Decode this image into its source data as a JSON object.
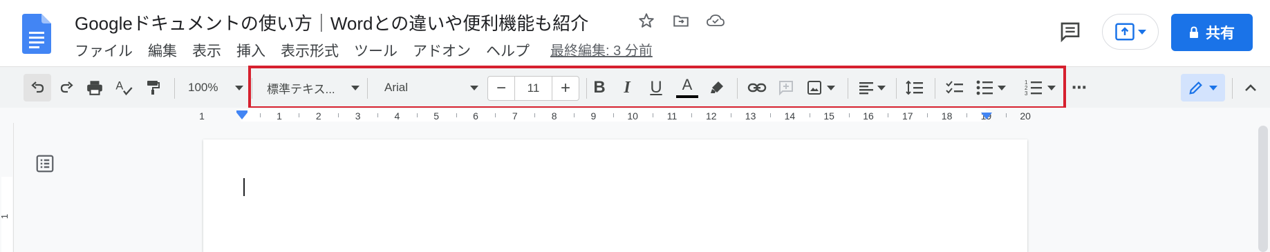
{
  "document": {
    "title": "Googleドキュメントの使い方｜Wordとの違いや便利機能も紹介",
    "last_edit": "最終編集: 3 分前"
  },
  "menu": [
    "ファイル",
    "編集",
    "表示",
    "挿入",
    "表示形式",
    "ツール",
    "アドオン",
    "ヘルプ"
  ],
  "header": {
    "share_label": "共有",
    "icons": [
      "star-icon",
      "move-to-folder-icon",
      "cloud-saved-icon",
      "comment-icon",
      "present-icon",
      "lock-icon"
    ]
  },
  "toolbar": {
    "zoom": "100%",
    "style": "標準テキス...",
    "font": "Arial",
    "font_size": "11",
    "minus": "−",
    "plus": "+",
    "bold": "B",
    "italic": "I",
    "underline": "U",
    "text_color": "A",
    "more": "⋯",
    "colors": {
      "highlight_frame": "#d6202e",
      "accent": "#1a73e8",
      "edit_mode_bg": "#d3e3fd"
    }
  },
  "ruler": {
    "labels": [
      "1",
      "1",
      "2",
      "3",
      "4",
      "5",
      "6",
      "7",
      "8",
      "9",
      "10",
      "11",
      "12",
      "13",
      "14",
      "15",
      "16",
      "17",
      "18",
      "19",
      "20"
    ],
    "left_label": "1"
  }
}
